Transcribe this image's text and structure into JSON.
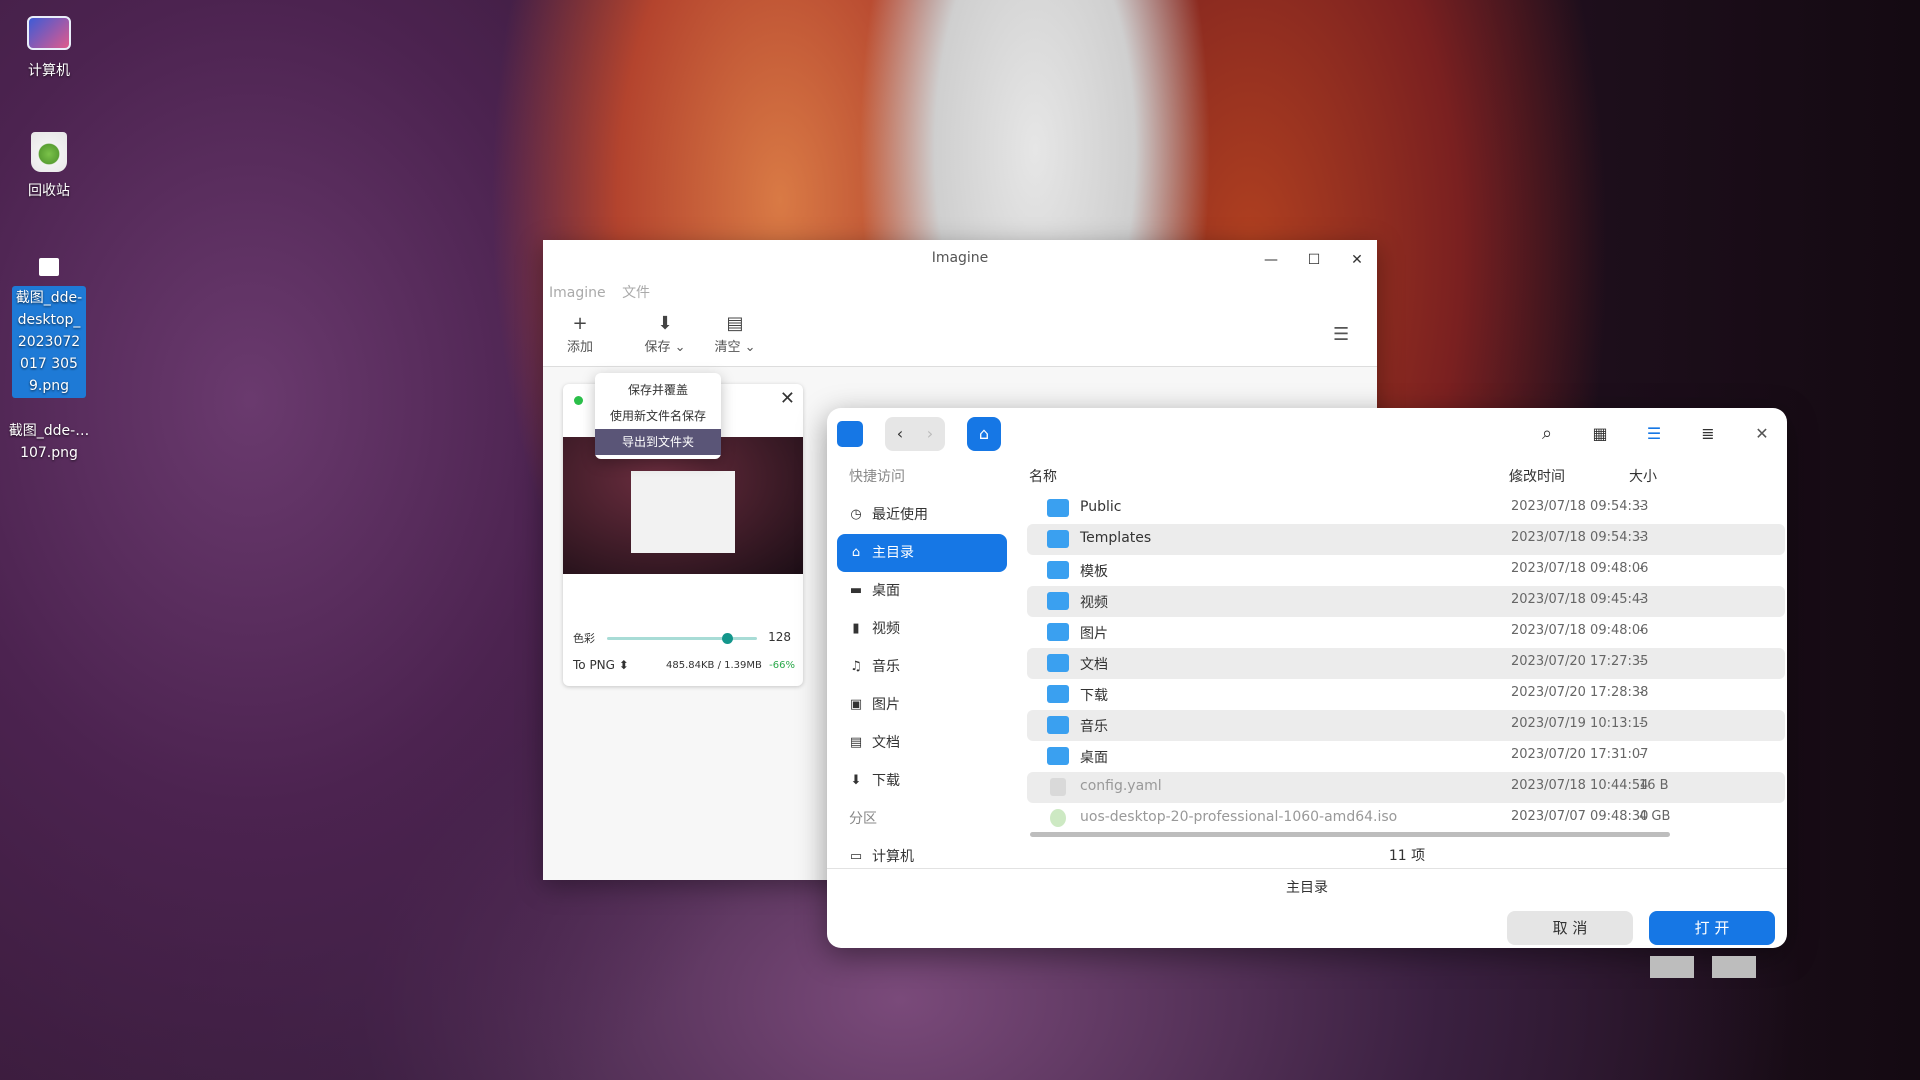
{
  "desktop": {
    "icons": [
      {
        "label": "计算机"
      },
      {
        "label": "回收站"
      },
      {
        "label": "截图_dde-desktop_2023072017 3059.png"
      },
      {
        "label": "截图_dde-…107.png"
      }
    ]
  },
  "imagine": {
    "title": "Imagine",
    "menu": [
      "Imagine",
      "文件"
    ],
    "toolbar": {
      "add": "添加",
      "save": "保存",
      "clear": "清空"
    },
    "save_menu": [
      "保存并覆盖",
      "使用新文件名保存",
      "导出到文件夹"
    ],
    "card": {
      "color_label": "色彩",
      "color_value": "128",
      "format": "To PNG",
      "size": "485.84KB / 1.39MB",
      "reduction": "-66%",
      "slider_fraction": 0.8
    }
  },
  "dialog": {
    "sidebar": {
      "quick_access": "快捷访问",
      "items": [
        {
          "label": "最近使用",
          "icon": "clock-icon"
        },
        {
          "label": "主目录",
          "icon": "home-icon"
        },
        {
          "label": "桌面",
          "icon": "desktop-icon"
        },
        {
          "label": "视频",
          "icon": "video-icon"
        },
        {
          "label": "音乐",
          "icon": "music-icon"
        },
        {
          "label": "图片",
          "icon": "picture-icon"
        },
        {
          "label": "文档",
          "icon": "document-icon"
        },
        {
          "label": "下载",
          "icon": "download-icon"
        }
      ],
      "partition": "分区",
      "computer": "计算机"
    },
    "columns": {
      "name": "名称",
      "modified": "修改时间",
      "size": "大小"
    },
    "files": [
      {
        "name": "Public",
        "date": "2023/07/18 09:54:33",
        "size": "-"
      },
      {
        "name": "Templates",
        "date": "2023/07/18 09:54:33",
        "size": "-"
      },
      {
        "name": "模板",
        "date": "2023/07/18 09:48:06",
        "size": "-"
      },
      {
        "name": "视频",
        "date": "2023/07/18 09:45:43",
        "size": "-"
      },
      {
        "name": "图片",
        "date": "2023/07/18 09:48:06",
        "size": "-"
      },
      {
        "name": "文档",
        "date": "2023/07/20 17:27:35",
        "size": "-"
      },
      {
        "name": "下载",
        "date": "2023/07/20 17:28:38",
        "size": "-"
      },
      {
        "name": "音乐",
        "date": "2023/07/19 10:13:15",
        "size": "-"
      },
      {
        "name": "桌面",
        "date": "2023/07/20 17:31:07",
        "size": "-"
      },
      {
        "name": "config.yaml",
        "date": "2023/07/18 10:44:54",
        "size": "16 B"
      },
      {
        "name": "uos-desktop-20-professional-1060-amd64.iso",
        "date": "2023/07/07 09:48:30",
        "size": "4 GB"
      }
    ],
    "count": "11 项",
    "current_path": "主目录",
    "cancel": "取 消",
    "open": "打 开",
    "accent": "#1677e5"
  }
}
